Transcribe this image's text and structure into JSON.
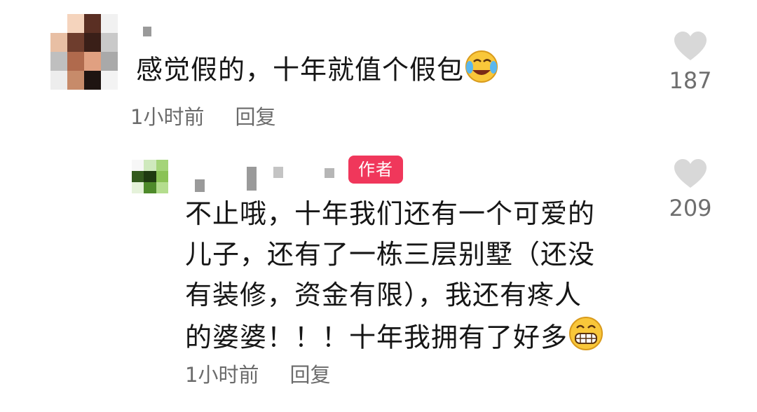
{
  "comments": [
    {
      "text_lines": [
        "感觉假的，十年就值个假包"
      ],
      "emoji": "laughing-crying-emoji",
      "time": "1小时前",
      "reply_label": "回复",
      "likes": "187"
    },
    {
      "badge": "作者",
      "text_lines": [
        "不止哦，十年我们还有一个可爱的",
        "儿子，还有了一栋三层别墅（还没",
        "有装修，资金有限），我还有疼人",
        "的婆婆！！！十年我拥有了好多"
      ],
      "emoji": "grinning-emoji",
      "time": "1小时前",
      "reply_label": "回复",
      "likes": "209"
    }
  ],
  "colors": {
    "badge_bg": "#f0375b",
    "meta_text": "#6b6b6b",
    "heart": "#d8d8d8"
  }
}
